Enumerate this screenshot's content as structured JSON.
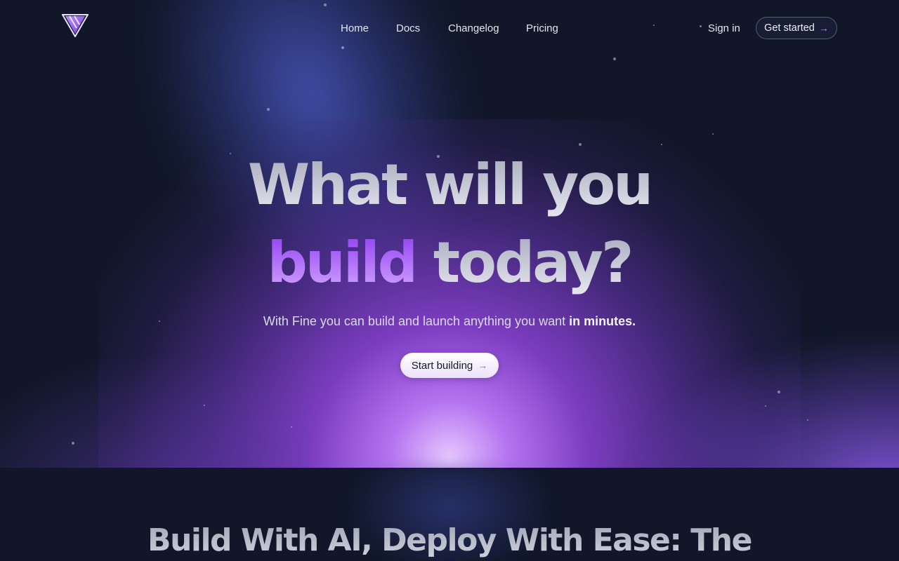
{
  "nav": {
    "links": [
      "Home",
      "Docs",
      "Changelog",
      "Pricing"
    ],
    "sign_in": "Sign in",
    "get_started": "Get started"
  },
  "hero": {
    "line1": "What will you",
    "line2_highlight": "build",
    "line2_rest": "today?",
    "subtitle": "With Fine you can build and launch anything you want",
    "subtitle_bold": "in minutes.",
    "cta": "Start building"
  },
  "section": {
    "heading": "Build With AI, Deploy With Ease: The"
  },
  "colors": {
    "background": "#111729",
    "accent": "#9a55ef",
    "headline_highlight": "#b06cf5"
  },
  "icons": {
    "logo": "triangle-v-logo-icon",
    "arrow": "arrow-right-icon"
  }
}
